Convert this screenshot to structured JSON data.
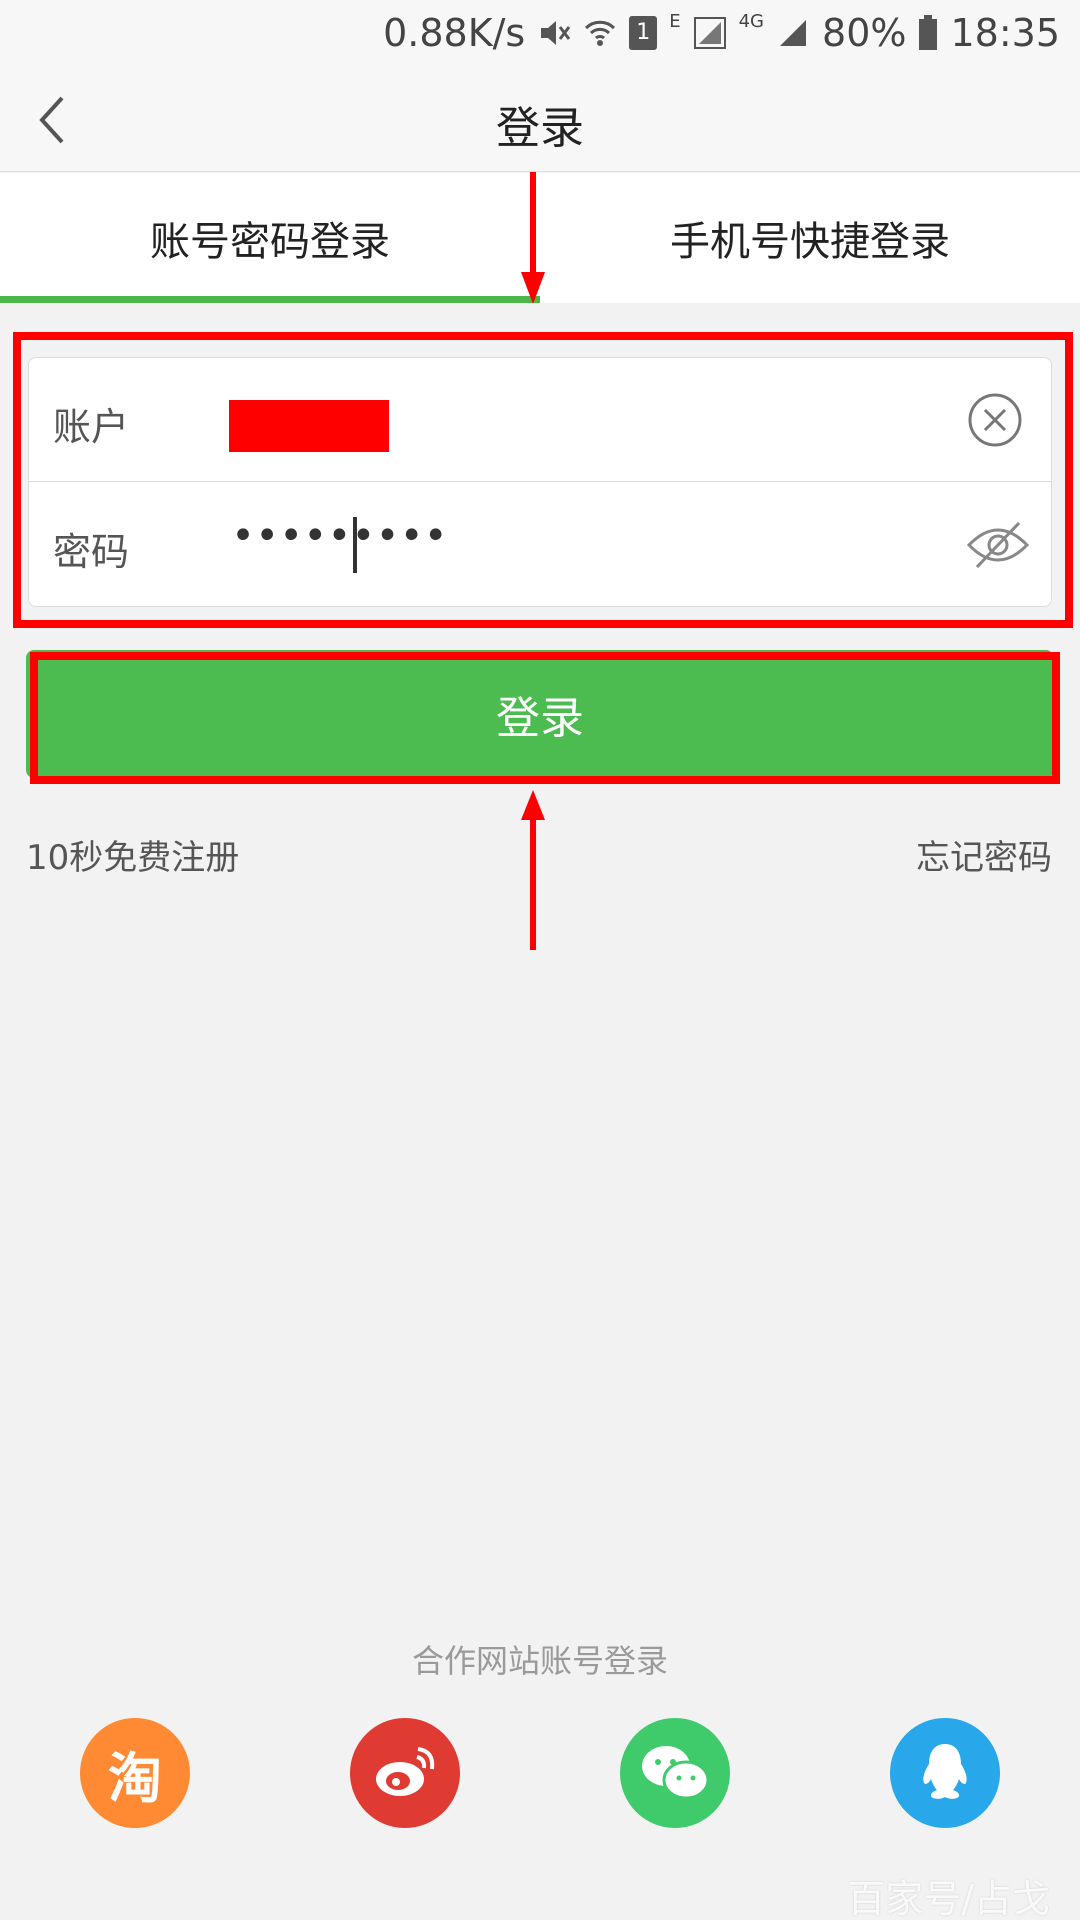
{
  "status_bar": {
    "speed": "0.88K/s",
    "sim": "1",
    "net_e": "E",
    "net_4g": "4G",
    "battery": "80%",
    "time": "18:35"
  },
  "header": {
    "title": "登录"
  },
  "tabs": [
    {
      "label": "账号密码登录",
      "active": true
    },
    {
      "label": "手机号快捷登录",
      "active": false
    }
  ],
  "form": {
    "account_label": "账户",
    "account_value": "",
    "password_label": "密码",
    "password_value": "•••••••••"
  },
  "login_button": "登录",
  "links": {
    "register": "10秒免费注册",
    "forgot": "忘记密码"
  },
  "partner": {
    "title": "合作网站账号登录",
    "items": [
      {
        "name": "taobao",
        "glyph": "淘",
        "color": "#ff8a33"
      },
      {
        "name": "weibo",
        "color": "#e03b32"
      },
      {
        "name": "wechat",
        "color": "#3fcb6b"
      },
      {
        "name": "qq",
        "color": "#28a8ea"
      }
    ]
  },
  "watermark": "百家号/占戈",
  "colors": {
    "accent": "#4cbb50",
    "highlight": "#ff0000"
  }
}
